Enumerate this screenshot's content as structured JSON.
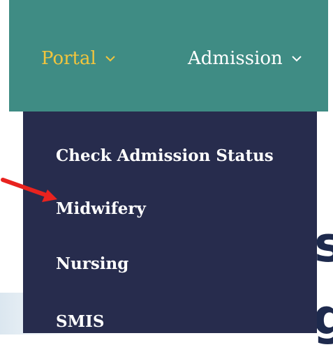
{
  "nav": {
    "portal_label": "Portal",
    "admission_label": "Admission"
  },
  "dropdown": {
    "items": [
      "Check Admission Status",
      "Midwifery",
      "Nursing",
      "SMIS"
    ]
  },
  "colors": {
    "navbar_bg": "#3f8c84",
    "active_nav": "#f2c53d",
    "dropdown_bg": "#272c4d",
    "annotation_arrow": "#e8231f"
  }
}
